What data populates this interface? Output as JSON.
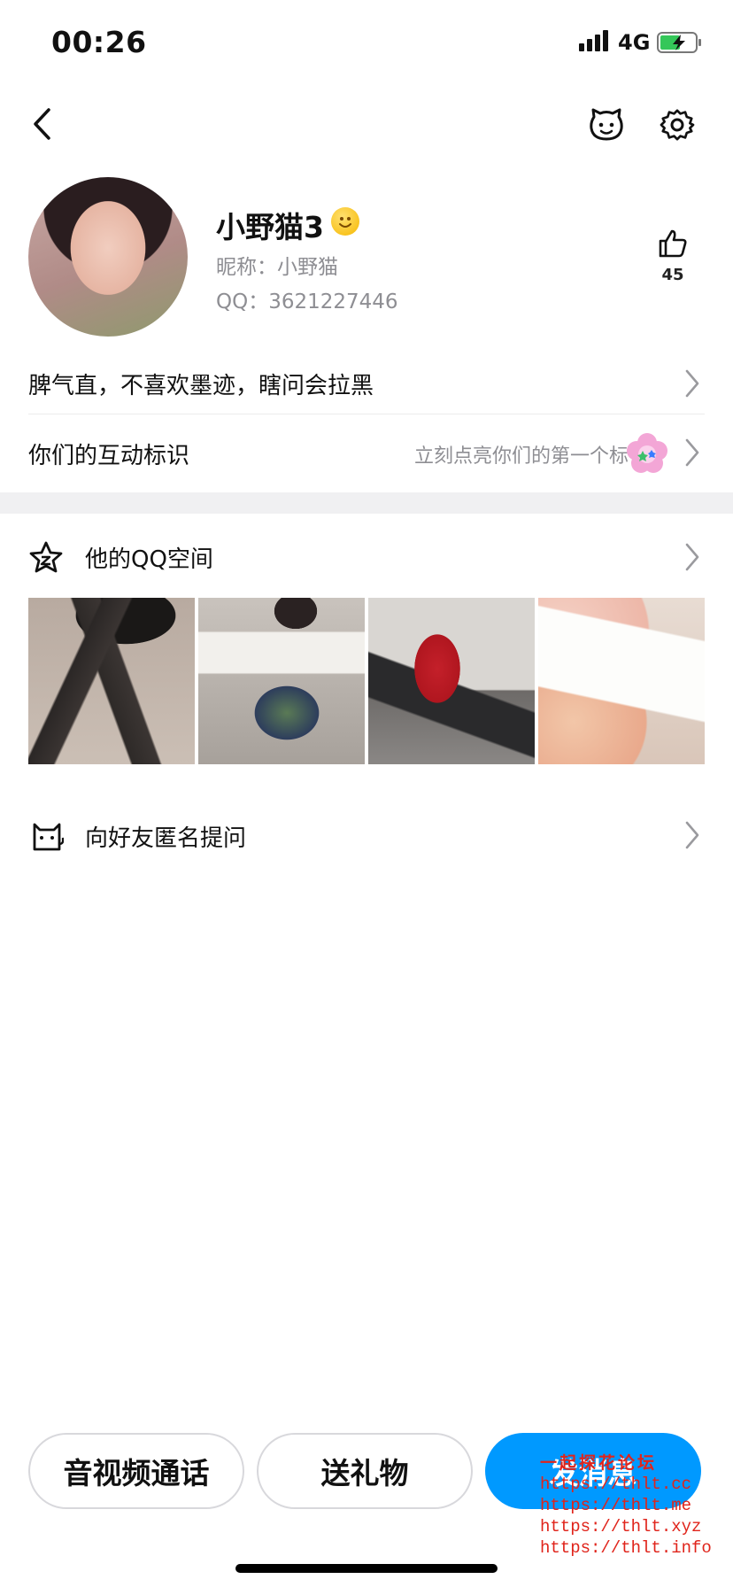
{
  "status_bar": {
    "time": "00:26",
    "network": "4G"
  },
  "profile": {
    "name": "小野猫3",
    "nickname": "昵称：小野猫",
    "qq": "QQ：3621227446",
    "likes": "45"
  },
  "rows": {
    "signature": "脾气直，不喜欢墨迹，瞎问会拉黑",
    "interaction_label": "你们的互动标识",
    "interaction_hint": "立刻点亮你们的第一个标识"
  },
  "qzone": {
    "title": "他的QQ空间"
  },
  "anonymous": {
    "title": "向好友匿名提问"
  },
  "actions": {
    "call": "音视频通话",
    "gift": "送礼物",
    "message": "发消息"
  },
  "watermark": {
    "title": "一起探花论坛",
    "urls": [
      "https://thlt.cc",
      "https://thlt.me",
      "https://thlt.xyz",
      "https://thlt.info"
    ]
  },
  "colors": {
    "accent": "#0099ff",
    "secondary_text": "#8e8e93",
    "watermark": "#e0241b"
  }
}
